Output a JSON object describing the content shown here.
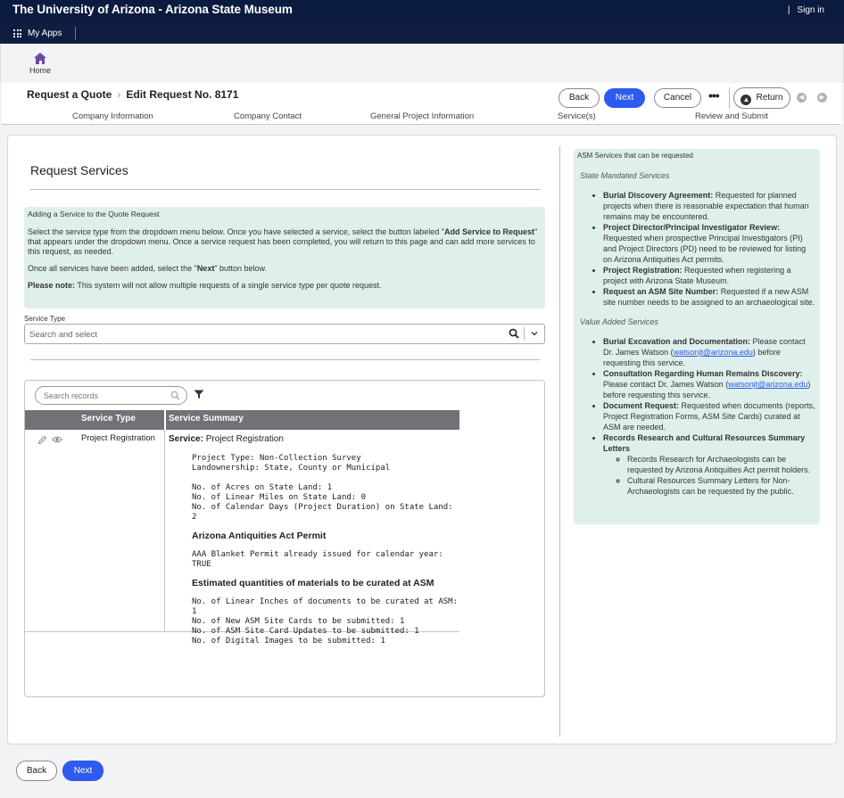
{
  "topbar": {
    "title": "The University of Arizona - Arizona State Museum",
    "signin": "Sign in"
  },
  "appbar": {
    "myapps": "My Apps"
  },
  "home": {
    "label": "Home"
  },
  "header": {
    "breadcrumb_parent": "Request a Quote",
    "breadcrumb_current": "Edit Request No. 8171",
    "back_label": "Back",
    "next_label": "Next",
    "cancel_label": "Cancel",
    "more_label": "•••",
    "return_label": "Return"
  },
  "steps": [
    "Company Information",
    "Company Contact",
    "General Project Information",
    "Service(s)",
    "Review and Submit"
  ],
  "main": {
    "title": "Request Services",
    "info": {
      "title": "Adding a Service to the Quote Request",
      "p1_a": "Select the service type from the dropdown menu below. Once you have selected a service, select the button labeled \"",
      "p1_b": "Add Service to Request",
      "p1_c": "\" that appears under the dropdown menu. Once a service request has been completed, you will return to this page and can add more services to this request, as needed.",
      "p2_a": "Once all services have been added, select the \"",
      "p2_b": "Next",
      "p2_c": "\" button below.",
      "p3_a": "Please note:",
      "p3_b": " This system will not allow multiple requests of a single service type per quote request."
    },
    "service_type_label": "Service Type",
    "service_type_placeholder": "Search and select",
    "grid": {
      "search_placeholder": "Search records",
      "columns": [
        "Service Type",
        "Service Summary"
      ],
      "row": {
        "type": "Project Registration",
        "summary_lead_label": "Service:",
        "summary_lead_value": " Project Registration",
        "lines1": [
          "Project Type: Non-Collection Survey",
          "Landownership: State, County or Municipal"
        ],
        "lines2": [
          "No. of Acres on State Land: 1",
          "No. of Linear Miles on State Land: 0",
          "No. of Calendar Days (Project Duration) on State Land: 2"
        ],
        "heading1": "Arizona Antiquities Act Permit",
        "lines3": [
          "AAA Blanket Permit already issued for calendar year: TRUE"
        ],
        "heading2": "Estimated quantities of materials to be curated at ASM",
        "lines4": [
          "No. of Linear Inches of documents to be curated at ASM: 1",
          "No. of New ASM Site Cards to be submitted: 1",
          "No. of ASM Site Card Updates to be submitted: 1",
          "No. of Digital Images to be submitted: 1"
        ]
      }
    }
  },
  "side": {
    "title": "ASM Services that can be requested",
    "sec1": "State Mandated Services",
    "items1": [
      {
        "bold": "Burial Discovery Agreement:",
        "text": " Requested for planned projects when there is reasonable expectation that human remains may be encountered."
      },
      {
        "bold": "Project Director/Principal Investigator Review:",
        "text": " Requested when prospective Principal Investigators (PI) and Project Directors (PD) need to be reviewed for listing on Arizona Antiquities Act permits."
      },
      {
        "bold": "Project Registration:",
        "text": " Requested when registering a project with Arizona State Museum."
      },
      {
        "bold": "Request an ASM Site Number:",
        "text": " Requested if a new ASM site number needs to be assigned to an archaeological site."
      }
    ],
    "sec2": "Value Added Services",
    "item_burial_bold": "Burial Excavation and Documentation:",
    "item_burial_text": " Please contact Dr. James Watson (",
    "item_burial_link": "watsonjt@arizona.edu",
    "item_burial_tail": ") before requesting this service.",
    "item_consult_bold": "Consultation Regarding Human Remains Discovery:",
    "item_consult_text": " Please contact Dr. James Watson (",
    "item_consult_link": "watsonjt@arizona.edu",
    "item_consult_tail": ") before requesting this service.",
    "item_doc_bold": "Document Request:",
    "item_doc_text": " Requested when documents (reports, Project Registration Forms, ASM Site Cards) curated at ASM are needed.",
    "item_rr_bold": "Records Research and Cultural Resources Summary Letters",
    "sub_items": [
      "Records Research for Archaeologists can be requested by Arizona Antiquities Act permit holders.",
      "Cultural Resources Summary Letters for Non-Archaeologists can be requested by the public."
    ]
  },
  "footer": {
    "back_label": "Back",
    "next_label": "Next"
  },
  "colors": {
    "navy": "#0b1b3f",
    "primary": "#2d5bf0",
    "info_bg": "#dff0ec",
    "grid_header": "#737078",
    "home_icon": "#6b4aa6"
  }
}
